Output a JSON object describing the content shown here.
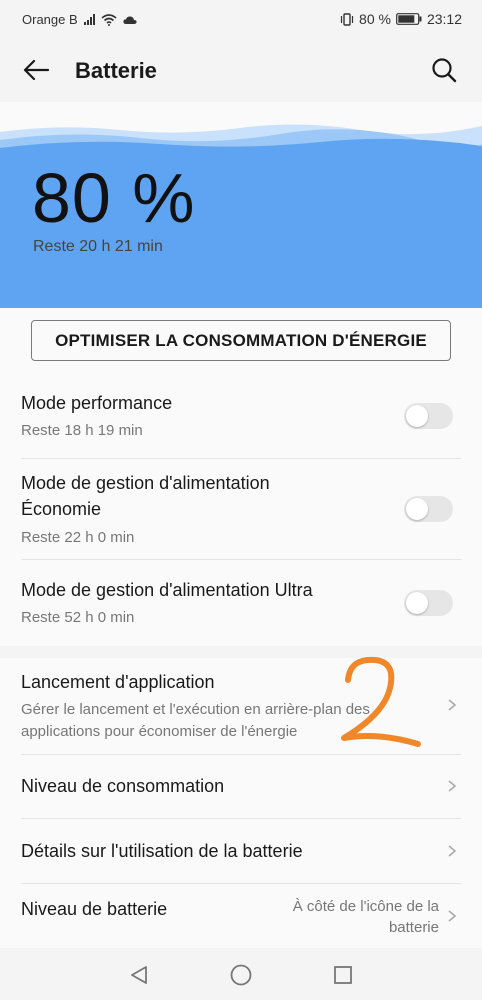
{
  "status_bar": {
    "carrier": "Orange B",
    "battery": "80 %",
    "time": "23:12"
  },
  "app_bar": {
    "title": "Batterie"
  },
  "hero": {
    "percent": "80 %",
    "remaining": "Reste 20 h 21 min",
    "wave_color": "#5ea4f3"
  },
  "optimize_button": "OPTIMISER LA CONSOMMATION D'ÉNERGIE",
  "modes": [
    {
      "label": "Mode performance",
      "sub": "Reste 18 h 19 min",
      "enabled": false
    },
    {
      "label_line1": "Mode de gestion d'alimentation",
      "label_line2": "Économie",
      "sub": "Reste 22 h 0 min",
      "enabled": false
    },
    {
      "label": "Mode de gestion d'alimentation Ultra",
      "sub": "Reste 52 h 0 min",
      "enabled": false
    }
  ],
  "settings": [
    {
      "label": "Lancement d'application",
      "sub_line1": "Gérer le lancement et l'exécution en arrière-plan des",
      "sub_line2": "applications pour économiser de l'énergie"
    },
    {
      "label": "Niveau de consommation"
    },
    {
      "label": "Détails sur l'utilisation de la batterie"
    },
    {
      "label": "Niveau de batterie",
      "value_line1": "À côté de l'icône de la",
      "value_line2": "batterie"
    }
  ],
  "annotation_color": "#f0882a"
}
